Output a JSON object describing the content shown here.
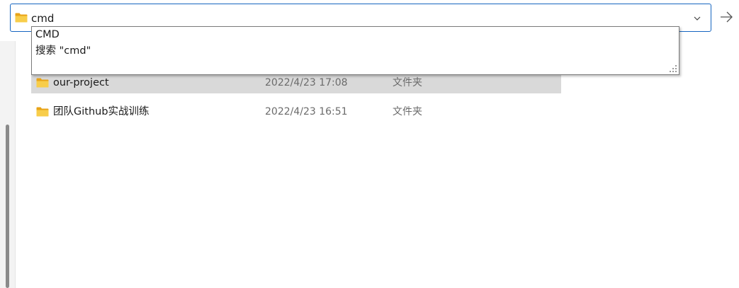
{
  "address_bar": {
    "value": "cmd",
    "folder_icon": "folder-icon",
    "dropdown_icon": "chevron-down-icon",
    "go_icon": "arrow-right-icon"
  },
  "suggestions": {
    "items": [
      {
        "label": "CMD"
      },
      {
        "label": "搜索 \"cmd\""
      }
    ]
  },
  "files": [
    {
      "name": "our-project",
      "date": "2022/4/23 17:08",
      "type": "文件夹",
      "icon": "folder-icon",
      "selected": true
    },
    {
      "name": "团队Github实战训练",
      "date": "2022/4/23 16:51",
      "type": "文件夹",
      "icon": "folder-icon",
      "selected": false
    }
  ],
  "colors": {
    "accent": "#1565c0",
    "folder": "#f4c542",
    "selected_row": "#d9d9d9"
  }
}
